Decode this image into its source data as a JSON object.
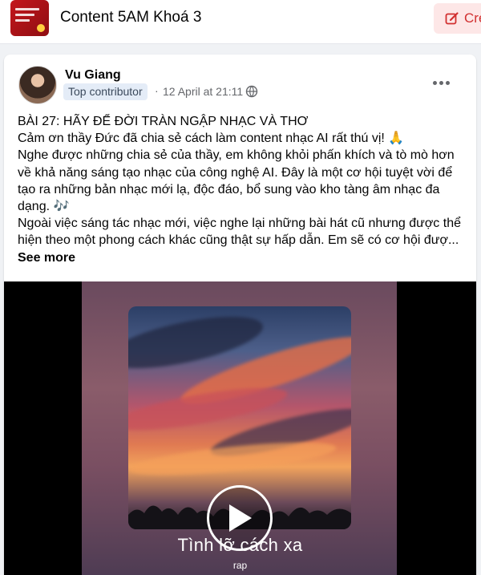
{
  "group": {
    "title": "Content 5AM Khoá 3",
    "create_label": "Cre",
    "thumbnail_icon": "group-cover-thumbnail"
  },
  "post": {
    "author": "Vu Giang",
    "badge": "Top contributor",
    "separator": "·",
    "time": "12 April at 21:11",
    "audience_icon": "globe-icon",
    "more_icon": "more-options-icon",
    "paragraphs": [
      "BÀI 27: HÃY ĐỂ ĐỜI TRÀN NGẬP NHẠC VÀ THƠ",
      "Cảm ơn thầy Đức đã chia sẻ cách làm content nhạc AI rất thú vị! 🙏",
      "Nghe được những chia sẻ của thầy, em không khỏi phấn khích và tò mò hơn về khả năng sáng tạo nhạc của công nghệ AI. Đây là một cơ hội tuyệt vời để tạo ra những bản nhạc mới lạ, độc đáo, bổ sung vào kho tàng âm nhạc đa dạng. 🎶",
      "Ngoài việc sáng tác nhạc mới, việc nghe lại những bài hát cũ nhưng được thể hiện theo một phong cách khác cũng thật sự hấp dẫn. Em sẽ có cơ hội đượ..."
    ],
    "see_more": "See more"
  },
  "media": {
    "song_title": "Tình lỡ cách xa",
    "song_subtitle": "rap",
    "play_icon": "play-icon"
  },
  "colors": {
    "accent_red": "#d13030",
    "create_bg": "#fde7e7",
    "badge_bg": "#e4ecf7",
    "muted_text": "#65676b"
  }
}
